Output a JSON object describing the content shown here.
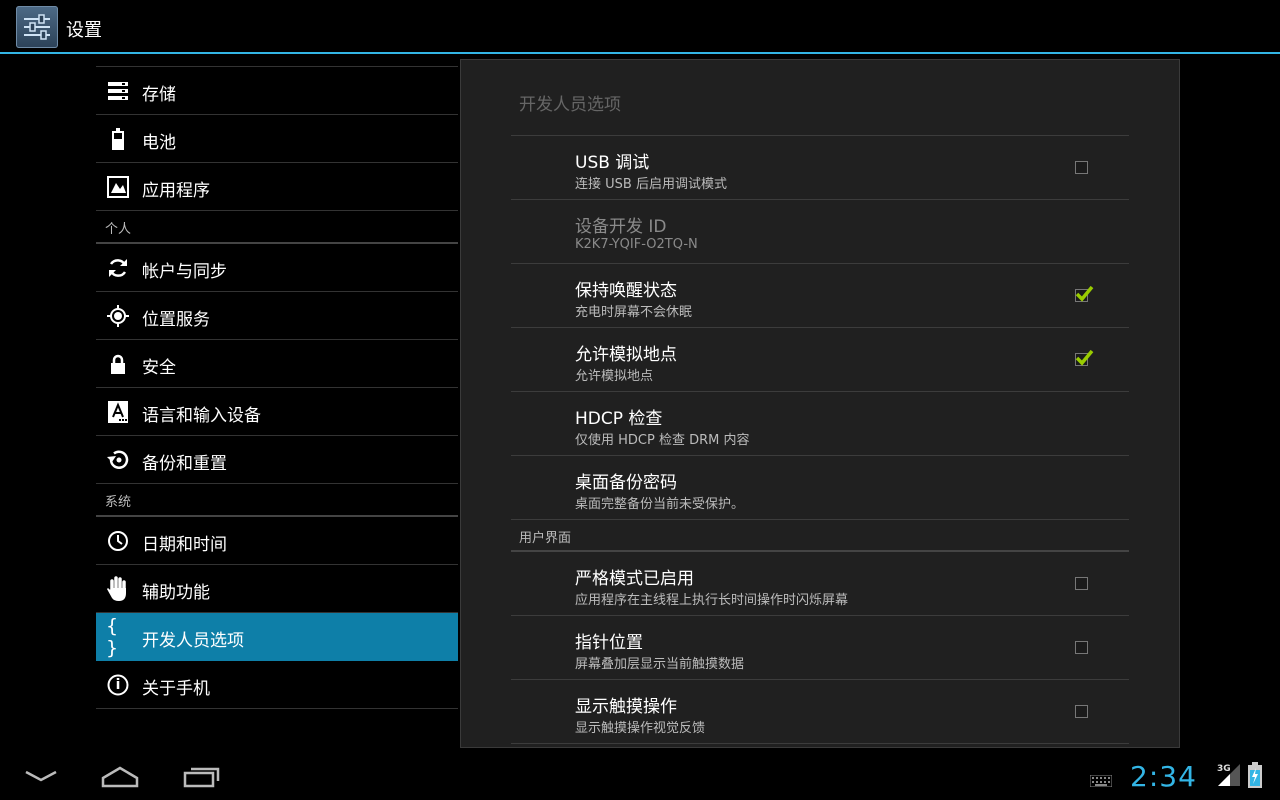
{
  "actionbar": {
    "title": "设置"
  },
  "sidebar": {
    "items": [
      {
        "type": "item",
        "label": "存储",
        "icon": "storage-icon"
      },
      {
        "type": "item",
        "label": "电池",
        "icon": "battery-icon"
      },
      {
        "type": "item",
        "label": "应用程序",
        "icon": "apps-icon"
      },
      {
        "type": "category",
        "label": "个人"
      },
      {
        "type": "item",
        "label": "帐户与同步",
        "icon": "sync-icon"
      },
      {
        "type": "item",
        "label": "位置服务",
        "icon": "location-icon"
      },
      {
        "type": "item",
        "label": "安全",
        "icon": "lock-icon"
      },
      {
        "type": "item",
        "label": "语言和输入设备",
        "icon": "language-icon"
      },
      {
        "type": "item",
        "label": "备份和重置",
        "icon": "backup-icon"
      },
      {
        "type": "category",
        "label": "系统"
      },
      {
        "type": "item",
        "label": "日期和时间",
        "icon": "clock-icon"
      },
      {
        "type": "item",
        "label": "辅助功能",
        "icon": "hand-icon"
      },
      {
        "type": "item",
        "label": "开发人员选项",
        "icon": "braces-icon",
        "active": true,
        "icon_text": "{ }"
      },
      {
        "type": "item",
        "label": "关于手机",
        "icon": "info-icon",
        "icon_text": "i"
      }
    ]
  },
  "panel": {
    "title": "开发人员选项",
    "items": [
      {
        "type": "pref",
        "title": "USB 调试",
        "summary": "连接 USB 后启用调试模式",
        "checkbox": true,
        "checked": false
      },
      {
        "type": "pref",
        "title": "设备开发 ID",
        "summary": "K2K7-YQIF-O2TQ-N",
        "checkbox": false,
        "disabled": true
      },
      {
        "type": "pref",
        "title": "保持唤醒状态",
        "summary": "充电时屏幕不会休眠",
        "checkbox": true,
        "checked": true
      },
      {
        "type": "pref",
        "title": "允许模拟地点",
        "summary": "允许模拟地点",
        "checkbox": true,
        "checked": true
      },
      {
        "type": "pref",
        "title": "HDCP 检查",
        "summary": "仅使用 HDCP 检查 DRM 内容",
        "checkbox": false
      },
      {
        "type": "pref",
        "title": "桌面备份密码",
        "summary": "桌面完整备份当前未受保护。",
        "checkbox": false
      },
      {
        "type": "category",
        "label": "用户界面"
      },
      {
        "type": "pref",
        "title": "严格模式已启用",
        "summary": "应用程序在主线程上执行长时间操作时闪烁屏幕",
        "checkbox": true,
        "checked": false
      },
      {
        "type": "pref",
        "title": "指针位置",
        "summary": "屏幕叠加层显示当前触摸数据",
        "checkbox": true,
        "checked": false
      },
      {
        "type": "pref",
        "title": "显示触摸操作",
        "summary": "显示触摸操作视觉反馈",
        "checkbox": true,
        "checked": false
      }
    ]
  },
  "navbar": {
    "buttons": [
      "back-icon",
      "home-icon",
      "recent-apps-icon"
    ],
    "clock": "2:34",
    "network": "3G",
    "status_icons": [
      "keyboard-icon",
      "signal-icon",
      "battery-charging-icon"
    ]
  },
  "colors": {
    "accent": "#33b5e5",
    "active_item": "#0e7fa8",
    "checkmark": "#99cc00"
  }
}
